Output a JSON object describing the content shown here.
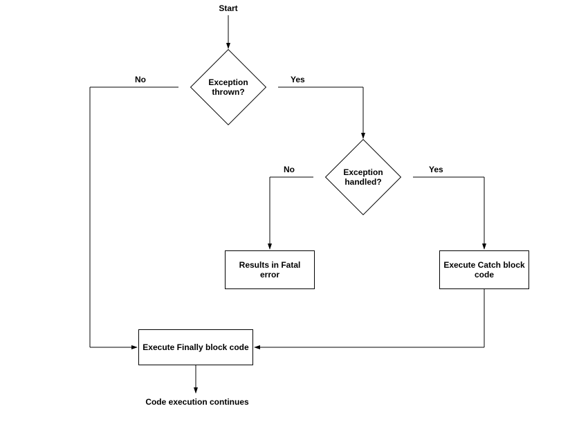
{
  "nodes": {
    "start": "Start",
    "decision1": "Exception thrown?",
    "decision1_no": "No",
    "decision1_yes": "Yes",
    "decision2": "Exception handled?",
    "decision2_no": "No",
    "decision2_yes": "Yes",
    "fatal": "Results in Fatal error",
    "catch": "Execute Catch block code",
    "finally": "Execute Finally block code",
    "continue": "Code execution continues"
  }
}
